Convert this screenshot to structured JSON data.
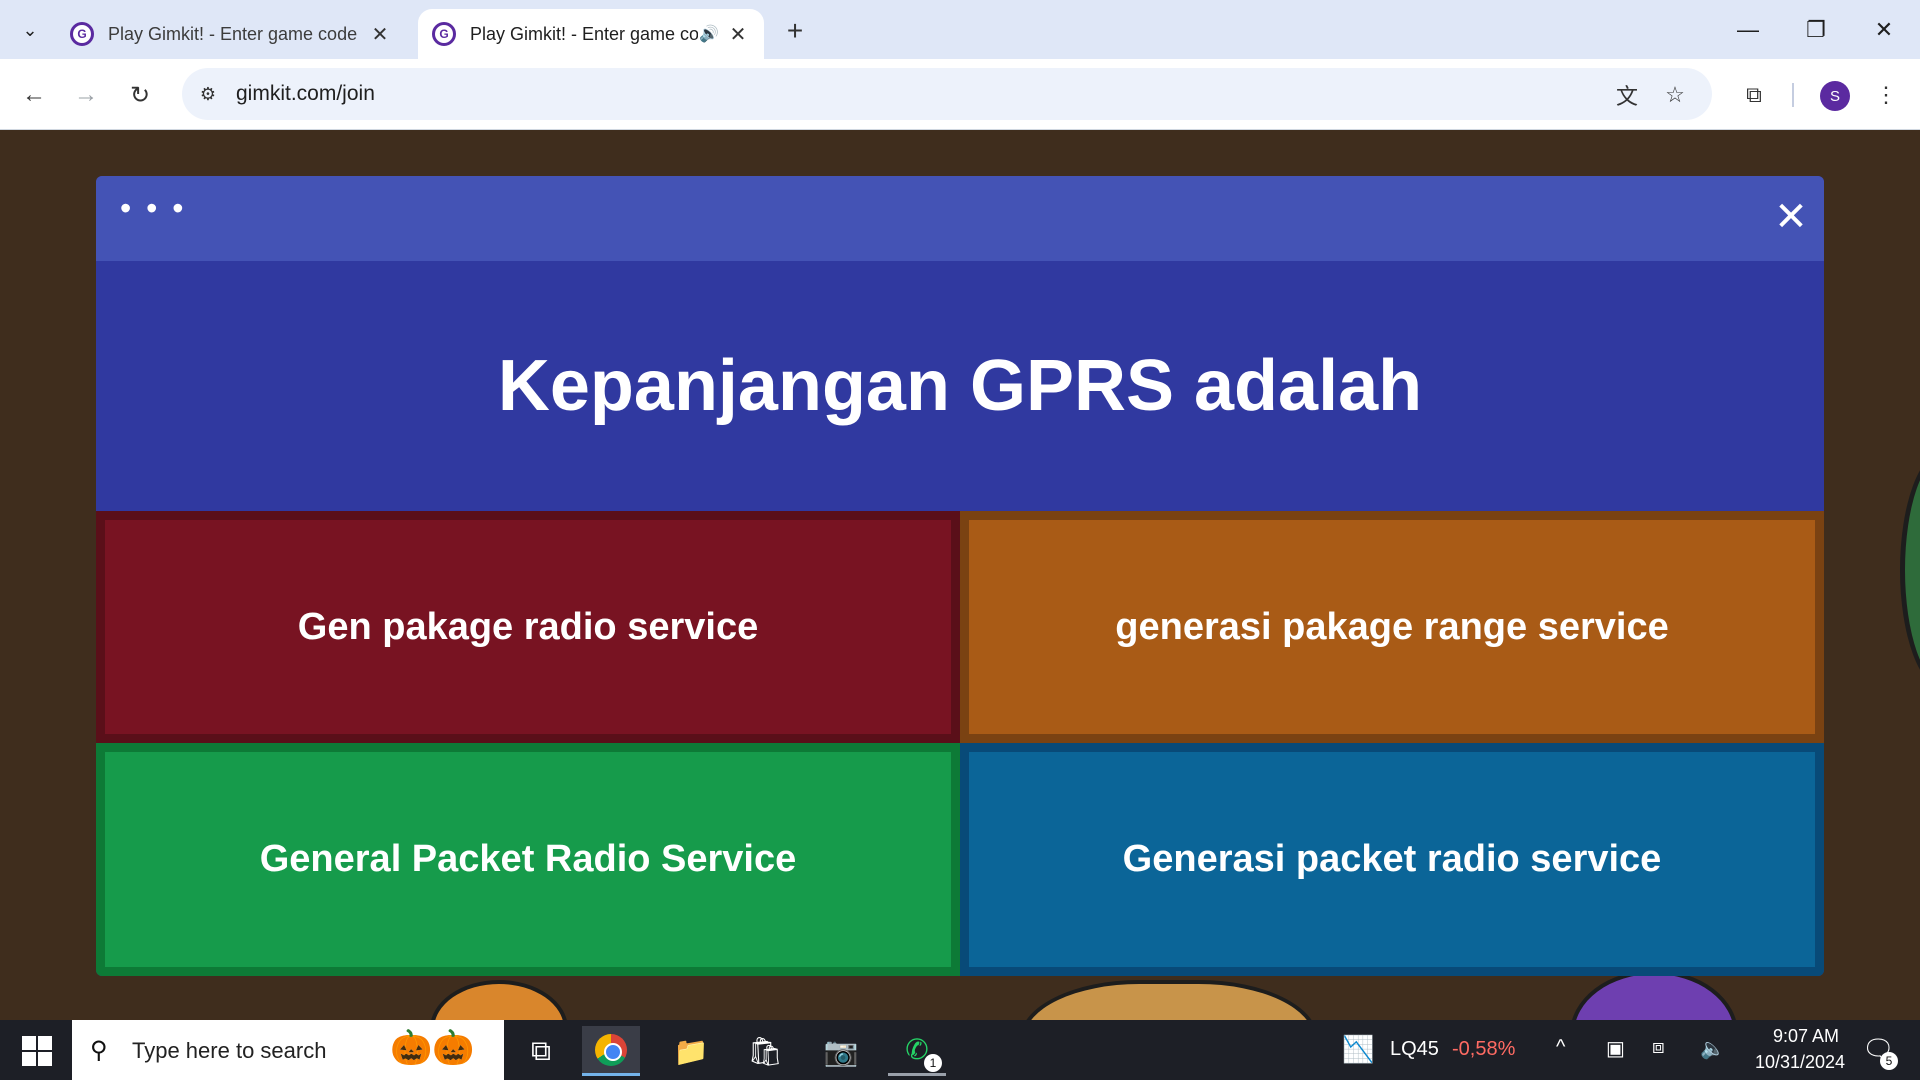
{
  "browser": {
    "tabs": [
      {
        "title": "Play Gimkit! - Enter game code",
        "favicon": "G",
        "active": false
      },
      {
        "title": "Play Gimkit! - Enter game co",
        "favicon": "G",
        "active": true
      }
    ],
    "address": "gimkit.com/join",
    "profile_initial": "S",
    "new_tab_symbol": "+"
  },
  "modal": {
    "menu_symbol": "• • •",
    "close_symbol": "✕",
    "question": "Kepanjangan GPRS adalah",
    "answers": [
      {
        "text": "Gen pakage radio service",
        "color": "#781322"
      },
      {
        "text": "generasi pakage range service",
        "color": "#a95b16"
      },
      {
        "text": "General Packet Radio Service",
        "color": "#169b4b"
      },
      {
        "text": "Generasi packet radio service",
        "color": "#0b6598"
      }
    ]
  },
  "taskbar": {
    "search_placeholder": "Type here to search",
    "whatsapp_badge": "1",
    "stock_name": "LQ45",
    "stock_change": "-0,58%",
    "time": "9:07 AM",
    "date": "10/31/2024",
    "notification_count": "5"
  },
  "icons": [
    "chevron-down-icon",
    "close-icon",
    "speaker-icon",
    "plus-icon",
    "minimize-icon",
    "restore-icon",
    "back-icon",
    "forward-icon",
    "reload-icon",
    "site-info-icon",
    "translate-icon",
    "star-icon",
    "extensions-icon",
    "more-icon",
    "windows-icon",
    "search-icon",
    "task-view-icon",
    "chrome-icon",
    "file-explorer-icon",
    "store-icon",
    "camera-icon",
    "whatsapp-icon",
    "notification-icon"
  ]
}
